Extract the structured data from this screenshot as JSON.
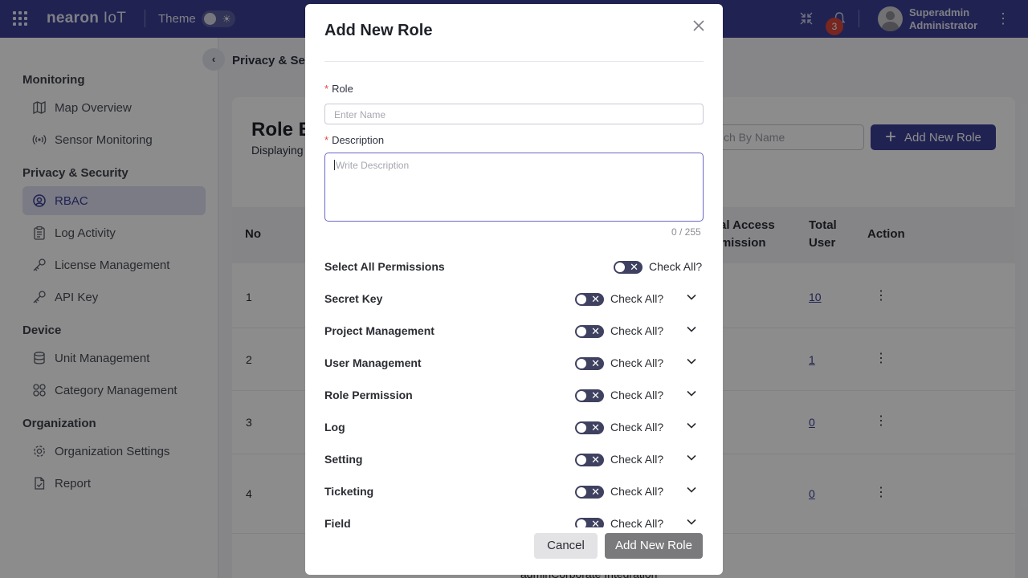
{
  "topbar": {
    "logo_main": "nearon",
    "logo_suffix": "IoT",
    "theme_label": "Theme",
    "notification_count": "3",
    "user_name": "Superadmin",
    "user_role": "Administrator"
  },
  "sidebar": {
    "sections": [
      {
        "title": "Monitoring"
      },
      {
        "title": "Privacy & Security"
      },
      {
        "title": "Device"
      },
      {
        "title": "Organization"
      }
    ],
    "items": [
      {
        "label": "Map Overview",
        "icon": "map-icon"
      },
      {
        "label": "Sensor Monitoring",
        "icon": "broadcast-icon"
      },
      {
        "label": "RBAC",
        "icon": "rbac-icon",
        "active": true
      },
      {
        "label": "Log Activity",
        "icon": "clipboard-icon"
      },
      {
        "label": "License Management",
        "icon": "key-icon"
      },
      {
        "label": "API Key",
        "icon": "key-icon"
      },
      {
        "label": "Unit Management",
        "icon": "database-icon"
      },
      {
        "label": "Category Management",
        "icon": "category-grid-icon"
      },
      {
        "label": "Organization Settings",
        "icon": "gear-icon"
      },
      {
        "label": "Report",
        "icon": "report-icon"
      }
    ]
  },
  "main": {
    "breadcrumb": "Privacy & Sec",
    "title": "Role B",
    "subtitle": "Displaying",
    "search_placeholder": "ch By Name",
    "add_button": "Add New Role",
    "columns": {
      "no": "No",
      "access": "tal Access",
      "access2": "rmission",
      "total_user": "Total",
      "total_user2": "User",
      "action": "Action"
    },
    "rows": [
      {
        "no": "1",
        "total_user": "10"
      },
      {
        "no": "2",
        "total_user": "1"
      },
      {
        "no": "3",
        "total_user": "0"
      },
      {
        "no": "4",
        "total_user": "0"
      }
    ],
    "partial_text": "adminCorporate Integration"
  },
  "modal": {
    "title": "Add New Role",
    "role_label": "Role",
    "role_placeholder": "Enter Name",
    "description_label": "Description",
    "description_placeholder": "Write Description",
    "counter": "0 / 255",
    "select_all_label": "Select All Permissions",
    "check_all": "Check All?",
    "permissions": [
      {
        "name": "Secret Key"
      },
      {
        "name": "Project Management"
      },
      {
        "name": "User Management"
      },
      {
        "name": "Role Permission"
      },
      {
        "name": "Log"
      },
      {
        "name": "Setting"
      },
      {
        "name": "Ticketing"
      },
      {
        "name": "Field"
      }
    ],
    "cancel": "Cancel",
    "submit": "Add New Role"
  },
  "colors": {
    "brand": "#3b3f96",
    "badge": "#d9463b",
    "required": "#e5483f"
  }
}
